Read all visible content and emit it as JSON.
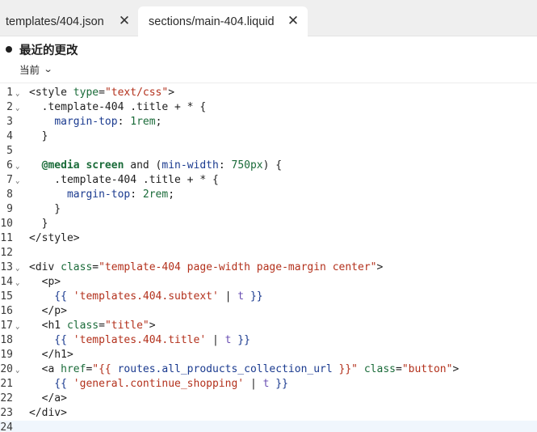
{
  "tabs": [
    {
      "label": "templates/404.json",
      "active": false
    },
    {
      "label": "sections/main-404.liquid",
      "active": true
    }
  ],
  "header": {
    "title": "最近的更改",
    "version_label": "当前"
  },
  "editor": {
    "lines": [
      {
        "n": "1",
        "fold": true
      },
      {
        "n": "2",
        "fold": true
      },
      {
        "n": "3",
        "fold": false
      },
      {
        "n": "4",
        "fold": false
      },
      {
        "n": "5",
        "fold": false
      },
      {
        "n": "6",
        "fold": true
      },
      {
        "n": "7",
        "fold": true
      },
      {
        "n": "8",
        "fold": false
      },
      {
        "n": "9",
        "fold": false
      },
      {
        "n": "10",
        "fold": false
      },
      {
        "n": "11",
        "fold": false
      },
      {
        "n": "12",
        "fold": false
      },
      {
        "n": "13",
        "fold": true
      },
      {
        "n": "14",
        "fold": true
      },
      {
        "n": "15",
        "fold": false
      },
      {
        "n": "16",
        "fold": false
      },
      {
        "n": "17",
        "fold": true
      },
      {
        "n": "18",
        "fold": false
      },
      {
        "n": "19",
        "fold": false
      },
      {
        "n": "20",
        "fold": true
      },
      {
        "n": "21",
        "fold": false
      },
      {
        "n": "22",
        "fold": false
      },
      {
        "n": "23",
        "fold": false
      },
      {
        "n": "24",
        "fold": false
      }
    ],
    "code": {
      "l1": [
        "<style ",
        "type",
        "=",
        "\"text/css\"",
        ">"
      ],
      "l2": "  .template-404 .title + * {",
      "l3": [
        "    ",
        "margin-top",
        ": ",
        "1rem",
        ";"
      ],
      "l4": "  }",
      "l6": [
        "  ",
        "@media",
        " ",
        "screen",
        " and (",
        "min-width",
        ": ",
        "750px",
        ") {"
      ],
      "l7": "    .template-404 .title + * {",
      "l8": [
        "      ",
        "margin-top",
        ": ",
        "2rem",
        ";"
      ],
      "l9": "    }",
      "l10": "  }",
      "l11": "</style>",
      "l13": [
        "<div ",
        "class",
        "=",
        "\"template-404 page-width page-margin center\"",
        ">"
      ],
      "l14": "  <p>",
      "l15": [
        "    {{ ",
        "'templates.404.subtext'",
        " | ",
        "t",
        " }}"
      ],
      "l16": "  </p>",
      "l17": [
        "  <h1 ",
        "class",
        "=",
        "\"title\"",
        ">"
      ],
      "l18": [
        "    {{ ",
        "'templates.404.title'",
        " | ",
        "t",
        " }}"
      ],
      "l19": "  </h1>",
      "l20": [
        "  <a ",
        "href",
        "=",
        "\"{{ ",
        "routes.all_products_collection_url",
        " }}\"",
        " ",
        "class",
        "=",
        "\"button\"",
        ">"
      ],
      "l21": [
        "    {{ ",
        "'general.continue_shopping'",
        " | ",
        "t",
        " }}"
      ],
      "l22": "  </a>",
      "l23": "</div>"
    }
  },
  "icons": {
    "close": "close-icon",
    "chevron": "chevron-down-icon",
    "fold": "fold-chevron-icon",
    "dot": "unsaved-dot-icon"
  }
}
